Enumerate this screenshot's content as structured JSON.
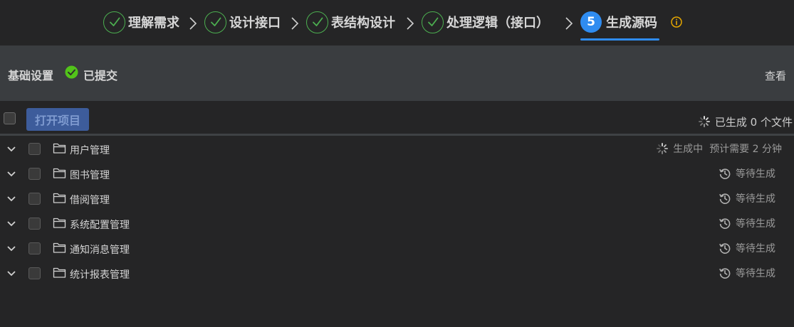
{
  "steps": [
    {
      "label": "理解需求",
      "state": "done"
    },
    {
      "label": "设计接口",
      "state": "done"
    },
    {
      "label": "表结构设计",
      "state": "done"
    },
    {
      "label": "处理逻辑（接口）",
      "state": "done"
    },
    {
      "label": "生成源码",
      "state": "active",
      "number": "5"
    }
  ],
  "settings": {
    "title": "基础设置",
    "submitted": "已提交",
    "view_link": "查看"
  },
  "toolbar": {
    "open_project": "打开项目",
    "generated_status": "已生成 0 个文件"
  },
  "modules": [
    {
      "name": "用户管理",
      "status": "生成中",
      "estimate": "预计需要 2 分钟",
      "state": "generating"
    },
    {
      "name": "图书管理",
      "status": "等待生成",
      "state": "waiting"
    },
    {
      "name": "借阅管理",
      "status": "等待生成",
      "state": "waiting"
    },
    {
      "name": "系统配置管理",
      "status": "等待生成",
      "state": "waiting"
    },
    {
      "name": "通知消息管理",
      "status": "等待生成",
      "state": "waiting"
    },
    {
      "name": "统计报表管理",
      "status": "等待生成",
      "state": "waiting"
    }
  ],
  "icons": {
    "done_step": "check-circle-icon",
    "step_separator": "chevron-right-icon",
    "info": "info-icon",
    "submitted": "check-badge-icon",
    "generating": "spinner-icon",
    "waiting": "history-icon",
    "folder": "folder-icon",
    "expand": "chevron-down-icon"
  },
  "colors": {
    "background": "#252526",
    "panel": "#3a3d40",
    "success": "#4caf50",
    "accent": "#2f8cf0",
    "warning": "#e6a700",
    "button": "#3d5c9b"
  }
}
